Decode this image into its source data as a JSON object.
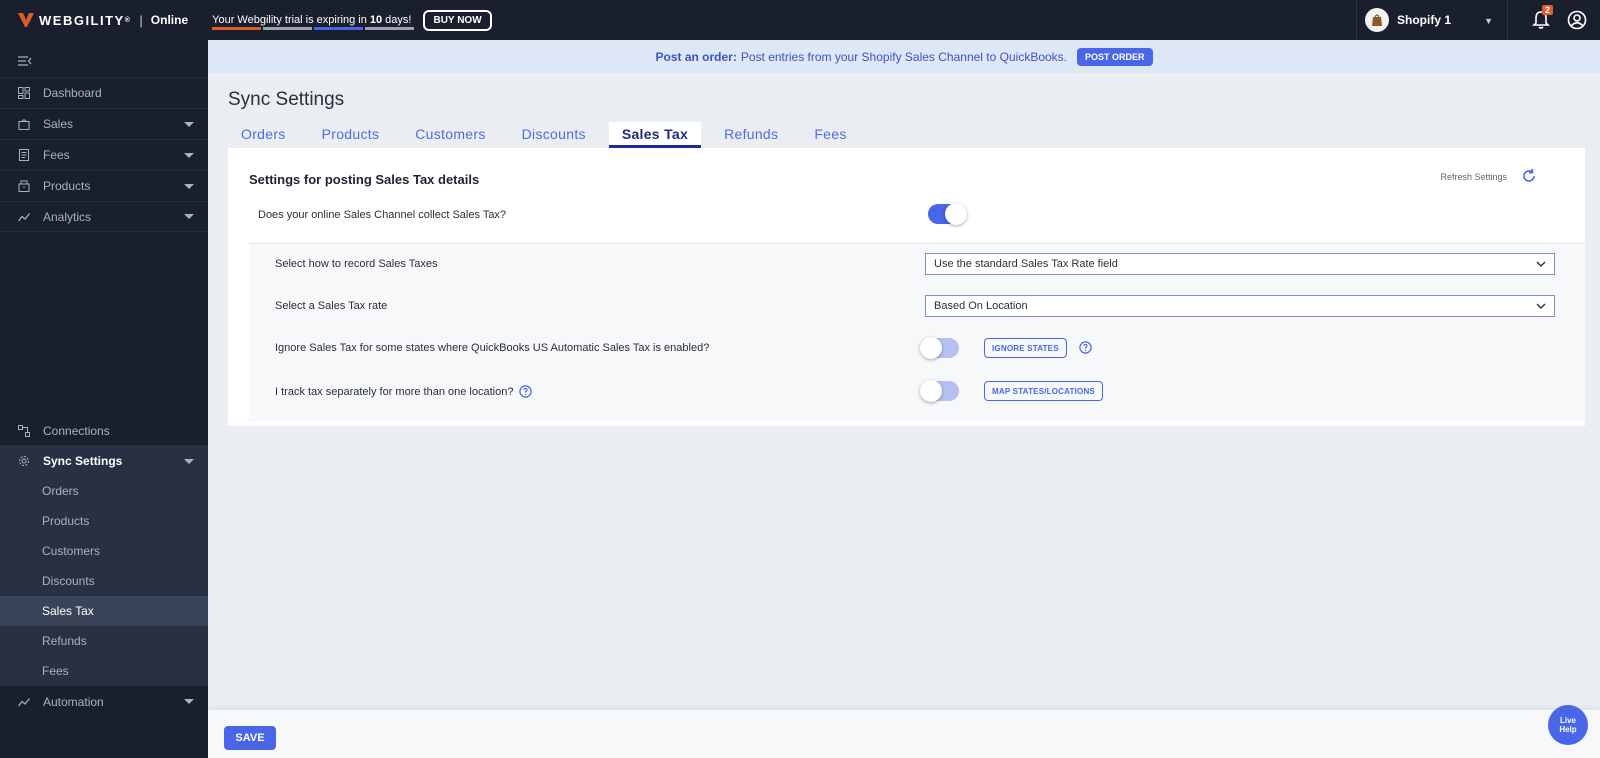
{
  "header": {
    "logo": "WEBGILITY",
    "logo_mark": "®",
    "edition": "Online",
    "trial_text_prefix": "Your Webgility trial is expiring in ",
    "trial_days": "10",
    "trial_text_suffix": " days!",
    "buy_label": "BUY NOW",
    "store_name": "Shopify 1",
    "notification_count": "2",
    "colors": {
      "bar": "#1a1f2e",
      "trial_segments": [
        "#e05a2a",
        "#9aa1b0",
        "#4a66e8",
        "#9aa1b0"
      ]
    }
  },
  "sidebar": {
    "items": [
      {
        "label": "Dashboard",
        "icon": "dashboard-icon"
      },
      {
        "label": "Sales",
        "icon": "bag-icon"
      },
      {
        "label": "Fees",
        "icon": "receipt-icon"
      },
      {
        "label": "Products",
        "icon": "box-icon"
      },
      {
        "label": "Analytics",
        "icon": "trend-icon"
      }
    ],
    "connections": "Connections",
    "sync_settings": "Sync Settings",
    "sync_sub": [
      "Orders",
      "Products",
      "Customers",
      "Discounts",
      "Sales Tax",
      "Refunds",
      "Fees"
    ],
    "selected_sub": "Sales Tax",
    "automation": "Automation"
  },
  "banner": {
    "lead": "Post an order:",
    "text": "Post entries from your Shopify Sales Channel to QuickBooks.",
    "button": "POST ORDER"
  },
  "main": {
    "title": "Sync Settings",
    "tabs": [
      "Orders",
      "Products",
      "Customers",
      "Discounts",
      "Sales Tax",
      "Refunds",
      "Fees"
    ],
    "active_tab": "Sales Tax",
    "panel_title": "Settings for posting Sales Tax details",
    "refresh_label": "Refresh Settings",
    "collect_question": "Does your online Sales Channel collect Sales Tax?",
    "collect_enabled": true,
    "record_label": "Select how to record Sales Taxes",
    "record_value": "Use the standard Sales Tax Rate field",
    "rate_label": "Select a Sales Tax rate",
    "rate_value": "Based On Location",
    "ignore_label": "Ignore Sales Tax for some states where QuickBooks US Automatic Sales Tax is enabled?",
    "ignore_enabled": false,
    "ignore_button": "IGNORE STATES",
    "track_label": "I track tax separately for more than one location?",
    "track_enabled": false,
    "map_button": "MAP STATES/LOCATIONS"
  },
  "footer": {
    "save_label": "SAVE",
    "live_help": [
      "Live",
      "Help"
    ]
  }
}
